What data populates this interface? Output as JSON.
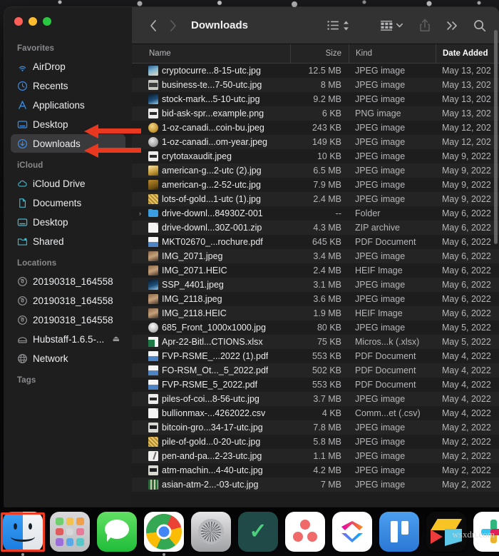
{
  "window": {
    "title": "Downloads",
    "traffic_lights": [
      "close",
      "minimize",
      "zoom"
    ]
  },
  "toolbar": {
    "back_label": "‹",
    "forward_label": "›",
    "view_list_icon": "list-view-icon",
    "sort_icon": "sort-chevrons-icon",
    "group_icon": "group-by-icon",
    "group_chevron": "chevron-down-icon",
    "share_icon": "share-icon",
    "more_icon": "more-chevrons-icon",
    "search_icon": "search-icon"
  },
  "sidebar": {
    "groups": [
      {
        "title": "Favorites",
        "items": [
          {
            "label": "AirDrop",
            "icon": "airdrop-icon",
            "selected": false
          },
          {
            "label": "Recents",
            "icon": "clock-icon",
            "selected": false
          },
          {
            "label": "Applications",
            "icon": "applications-icon",
            "selected": false
          },
          {
            "label": "Desktop",
            "icon": "desktop-icon",
            "selected": false
          },
          {
            "label": "Downloads",
            "icon": "downloads-icon",
            "selected": true
          }
        ]
      },
      {
        "title": "iCloud",
        "items": [
          {
            "label": "iCloud Drive",
            "icon": "cloud-icon",
            "selected": false
          },
          {
            "label": "Documents",
            "icon": "document-icon",
            "selected": false
          },
          {
            "label": "Desktop",
            "icon": "desktop-icon",
            "selected": false
          },
          {
            "label": "Shared",
            "icon": "shared-folder-icon",
            "selected": false
          }
        ]
      },
      {
        "title": "Locations",
        "items": [
          {
            "label": "20190318_164558",
            "icon": "disc-icon",
            "selected": false
          },
          {
            "label": "20190318_164558",
            "icon": "disc-icon",
            "selected": false
          },
          {
            "label": "20190318_164558",
            "icon": "disc-icon",
            "selected": false
          },
          {
            "label": "Hubstaff-1.6.5-...",
            "icon": "drive-icon",
            "selected": false,
            "eject": "⏏"
          },
          {
            "label": "Network",
            "icon": "network-icon",
            "selected": false
          }
        ]
      },
      {
        "title": "Tags",
        "items": []
      }
    ]
  },
  "columns": {
    "name": "Name",
    "size": "Size",
    "kind": "Kind",
    "date_added": "Date Added"
  },
  "files": [
    {
      "name": "cryptocurre...8-15-utc.jpg",
      "size": "12.5 MB",
      "kind": "JPEG image",
      "date": "May 13, 202",
      "icon": "photo-blue"
    },
    {
      "name": "business-te...7-50-utc.jpg",
      "size": "8 MB",
      "kind": "JPEG image",
      "date": "May 13, 202",
      "icon": "photo-wide"
    },
    {
      "name": "stock-mark...5-10-utc.jpg",
      "size": "9.2 MB",
      "kind": "JPEG image",
      "date": "May 13, 202",
      "icon": "photo-chart"
    },
    {
      "name": "bid-ask-spr...example.png",
      "size": "6 KB",
      "kind": "PNG image",
      "date": "May 13, 202",
      "icon": "bar-white"
    },
    {
      "name": "1-oz-canadi...coin-bu.jpeg",
      "size": "243 KB",
      "kind": "JPEG image",
      "date": "May 12, 202",
      "icon": "coin-gold"
    },
    {
      "name": "1-oz-canadi...om-year.jpeg",
      "size": "149 KB",
      "kind": "JPEG image",
      "date": "May 12, 202",
      "icon": "coin-silver"
    },
    {
      "name": "crytotaxaudit.jpeg",
      "size": "10 KB",
      "kind": "JPEG image",
      "date": "May 9, 2022",
      "icon": "bar-white"
    },
    {
      "name": "american-g...2-utc (2).jpg",
      "size": "6.5 MB",
      "kind": "JPEG image",
      "date": "May 9, 2022",
      "icon": "gold-bars"
    },
    {
      "name": "american-g...2-52-utc.jpg",
      "size": "7.9 MB",
      "kind": "JPEG image",
      "date": "May 9, 2022",
      "icon": "gold-dark"
    },
    {
      "name": "lots-of-gold...1-utc (1).jpg",
      "size": "2.4 MB",
      "kind": "JPEG image",
      "date": "May 9, 2022",
      "icon": "gold-pile"
    },
    {
      "name": "drive-downl...84930Z-001",
      "size": "--",
      "kind": "Folder",
      "date": "May 6, 2022",
      "icon": "folder",
      "disclosure": "›"
    },
    {
      "name": "drive-downl...30Z-001.zip",
      "size": "4.3 MB",
      "kind": "ZIP archive",
      "date": "May 6, 2022",
      "icon": "zip"
    },
    {
      "name": "MKT02670_...rochure.pdf",
      "size": "645 KB",
      "kind": "PDF Document",
      "date": "May 6, 2022",
      "icon": "pdf"
    },
    {
      "name": "IMG_2071.jpeg",
      "size": "3.4 MB",
      "kind": "JPEG image",
      "date": "May 6, 2022",
      "icon": "port"
    },
    {
      "name": "IMG_2071.HEIC",
      "size": "2.4 MB",
      "kind": "HEIF Image",
      "date": "May 6, 2022",
      "icon": "port"
    },
    {
      "name": "SSP_4401.jpeg",
      "size": "3.1 MB",
      "kind": "JPEG image",
      "date": "May 6, 2022",
      "icon": "photo-chart"
    },
    {
      "name": "IMG_2118.jpeg",
      "size": "3.6 MB",
      "kind": "JPEG image",
      "date": "May 6, 2022",
      "icon": "port"
    },
    {
      "name": "IMG_2118.HEIC",
      "size": "1.9 MB",
      "kind": "HEIF Image",
      "date": "May 6, 2022",
      "icon": "port"
    },
    {
      "name": "685_Front_1000x1000.jpg",
      "size": "80 KB",
      "kind": "JPEG image",
      "date": "May 5, 2022",
      "icon": "orb"
    },
    {
      "name": "Apr-22-Bitl...CTIONS.xlsx",
      "size": "75 KB",
      "kind": "Micros...k (.xlsx)",
      "date": "May 5, 2022",
      "icon": "xls"
    },
    {
      "name": "FVP-RSME_...2022 (1).pdf",
      "size": "553 KB",
      "kind": "PDF Document",
      "date": "May 4, 2022",
      "icon": "pdf"
    },
    {
      "name": "FO-RSM_Ot..._5_2022.pdf",
      "size": "502 KB",
      "kind": "PDF Document",
      "date": "May 4, 2022",
      "icon": "pdf"
    },
    {
      "name": "FVP-RSME_5_2022.pdf",
      "size": "553 KB",
      "kind": "PDF Document",
      "date": "May 4, 2022",
      "icon": "pdf"
    },
    {
      "name": "piles-of-coi...8-56-utc.jpg",
      "size": "3.7 MB",
      "kind": "JPEG image",
      "date": "May 4, 2022",
      "icon": "bar-white"
    },
    {
      "name": "bullionmax-...4262022.csv",
      "size": "4 KB",
      "kind": "Comm...et (.csv)",
      "date": "May 4, 2022",
      "icon": "csv"
    },
    {
      "name": "bitcoin-gro...34-17-utc.jpg",
      "size": "7.8 MB",
      "kind": "JPEG image",
      "date": "May 2, 2022",
      "icon": "atm"
    },
    {
      "name": "pile-of-gold...0-20-utc.jpg",
      "size": "5.8 MB",
      "kind": "JPEG image",
      "date": "May 2, 2022",
      "icon": "gold-pile"
    },
    {
      "name": "pen-and-pa...2-23-utc.jpg",
      "size": "1.1 MB",
      "kind": "JPEG image",
      "date": "May 2, 2022",
      "icon": "pen"
    },
    {
      "name": "atm-machin...4-40-utc.jpg",
      "size": "4.2 MB",
      "kind": "JPEG image",
      "date": "May 2, 2022",
      "icon": "atm"
    },
    {
      "name": "asian-atm-2...-03-utc.jpg",
      "size": "7 MB",
      "kind": "JPEG image",
      "date": "May 2, 2022",
      "icon": "asian-atm"
    }
  ],
  "annotations": {
    "arrow_desktop": "red-arrow-pointing-to-desktop",
    "arrow_downloads": "red-arrow-pointing-to-downloads",
    "dock_highlight": "red-box-around-finder-dock-icon",
    "accent_color": "#e8381f"
  },
  "dock": {
    "items": [
      {
        "label": "Finder",
        "icon": "finder-icon",
        "running": true
      },
      {
        "label": "Launchpad",
        "icon": "launchpad-icon",
        "running": false
      },
      {
        "label": "Messages",
        "icon": "messages-icon",
        "running": false
      },
      {
        "label": "Google Chrome",
        "icon": "chrome-icon",
        "running": true
      },
      {
        "label": "System Preferences",
        "icon": "gear-icon",
        "running": false
      },
      {
        "label": "Wrike",
        "icon": "wrike-icon",
        "running": false
      },
      {
        "label": "Asana",
        "icon": "asana-icon",
        "running": false
      },
      {
        "label": "ClickUp",
        "icon": "clickup-icon",
        "running": false
      },
      {
        "label": "Trello",
        "icon": "trello-icon",
        "running": false
      },
      {
        "label": "Prezi",
        "icon": "prezi-icon",
        "running": false
      },
      {
        "label": "Slack",
        "icon": "slack-icon",
        "running": false
      }
    ]
  },
  "watermark": {
    "text": "wsxdn.com"
  }
}
